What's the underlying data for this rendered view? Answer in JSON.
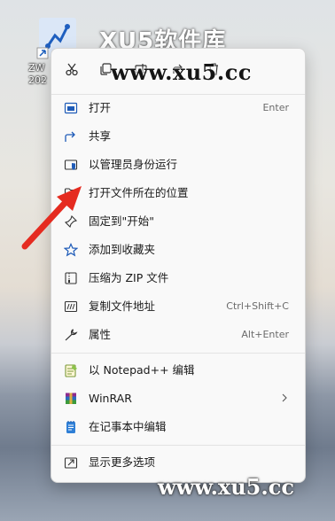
{
  "desktop": {
    "icon_label": "ZW\n202"
  },
  "watermarks": {
    "top": "XU5软件库",
    "middle": "www.xu5.cc",
    "bottom": "www.xu5.cc"
  },
  "quick_actions": [
    {
      "icon": "cut-icon"
    },
    {
      "icon": "copy-icon"
    },
    {
      "icon": "rename-icon"
    },
    {
      "icon": "share-icon"
    },
    {
      "icon": "delete-icon"
    }
  ],
  "menu": {
    "items": [
      {
        "label": "打开",
        "shortcut": "Enter",
        "icon": "open-icon"
      },
      {
        "label": "共享",
        "shortcut": "",
        "icon": "share-icon"
      },
      {
        "label": "以管理员身份运行",
        "shortcut": "",
        "icon": "shield-icon"
      },
      {
        "label": "打开文件所在的位置",
        "shortcut": "",
        "icon": "folder-icon"
      },
      {
        "label": "固定到\"开始\"",
        "shortcut": "",
        "icon": "pin-icon"
      },
      {
        "label": "添加到收藏夹",
        "shortcut": "",
        "icon": "star-icon"
      },
      {
        "label": "压缩为 ZIP 文件",
        "shortcut": "",
        "icon": "zip-icon"
      },
      {
        "label": "复制文件地址",
        "shortcut": "Ctrl+Shift+C",
        "icon": "path-icon"
      },
      {
        "label": "属性",
        "shortcut": "Alt+Enter",
        "icon": "wrench-icon"
      },
      {
        "label": "以 Notepad++ 编辑",
        "shortcut": "",
        "icon": "notepadpp-icon"
      },
      {
        "label": "WinRAR",
        "shortcut": "",
        "icon": "winrar-icon"
      },
      {
        "label": "在记事本中编辑",
        "shortcut": "",
        "icon": "notepad-icon"
      },
      {
        "label": "显示更多选项",
        "shortcut": "",
        "icon": "more-options-icon"
      }
    ]
  }
}
